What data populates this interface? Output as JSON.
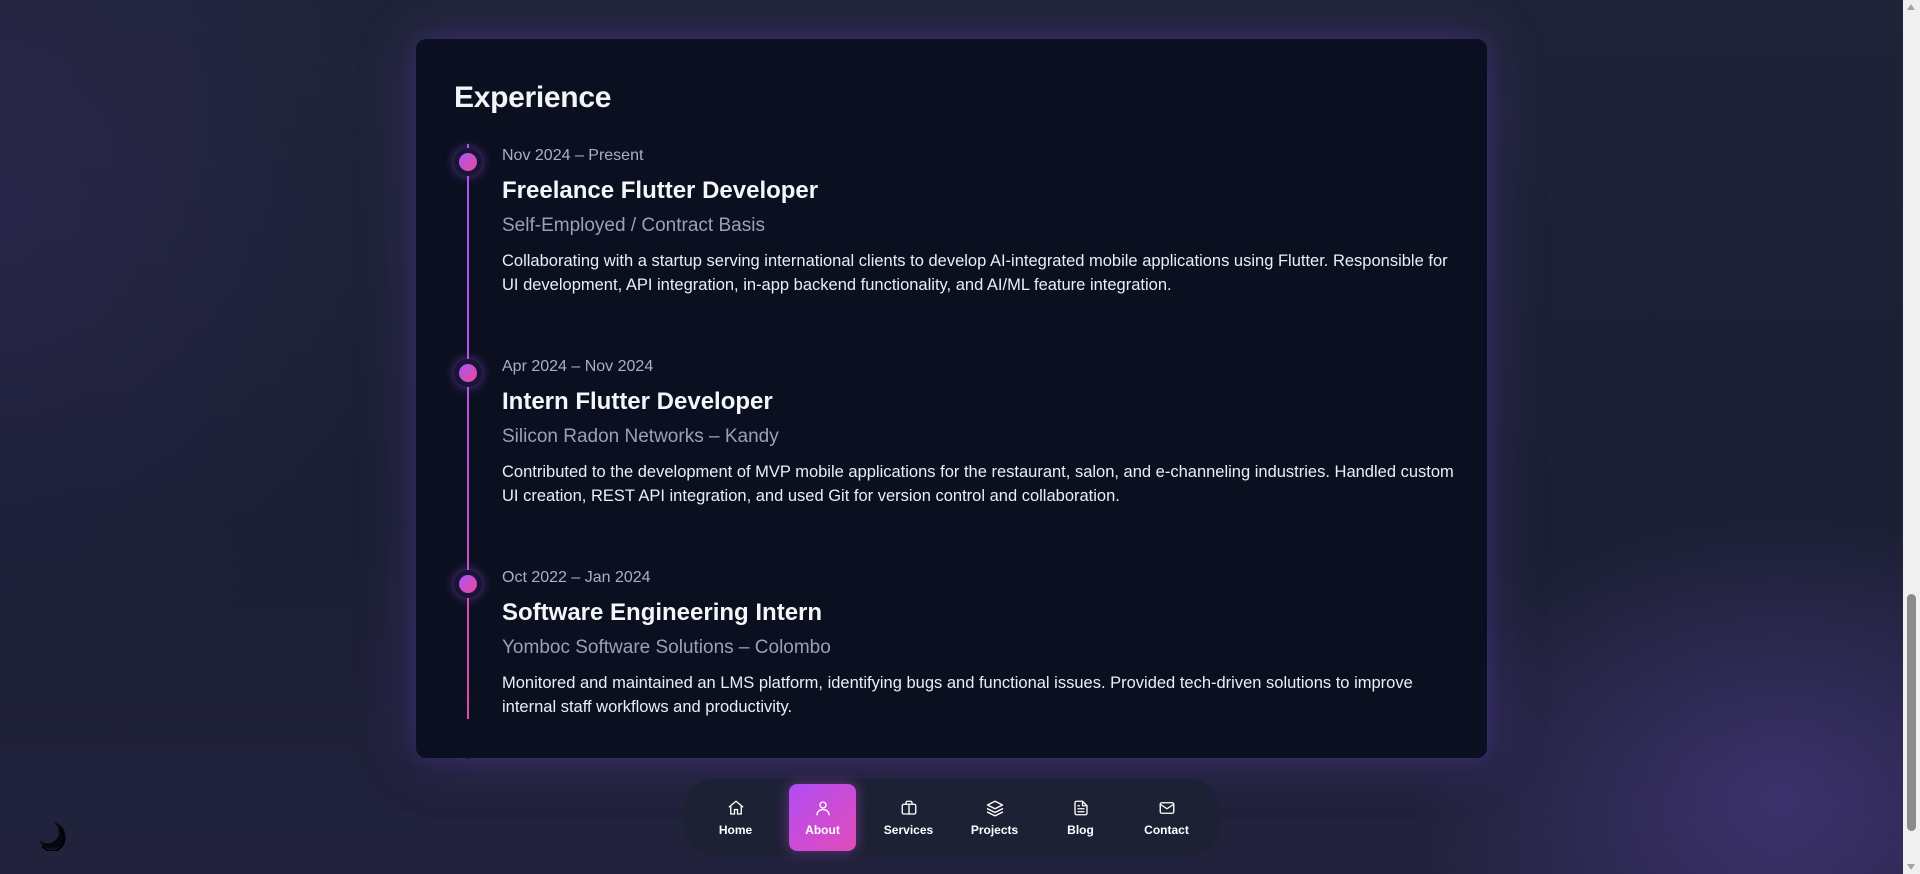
{
  "section": {
    "title": "Experience"
  },
  "experience": [
    {
      "date": "Nov 2024 – Present",
      "role": "Freelance Flutter Developer",
      "company": "Self-Employed / Contract Basis",
      "description": "Collaborating with a startup serving international clients to develop AI-integrated mobile applications using Flutter. Responsible for UI development, API integration, in-app backend functionality, and AI/ML feature integration."
    },
    {
      "date": "Apr 2024 – Nov 2024",
      "role": "Intern Flutter Developer",
      "company": "Silicon Radon Networks – Kandy",
      "description": "Contributed to the development of MVP mobile applications for the restaurant, salon, and e-channeling industries. Handled custom UI creation, REST API integration, and used Git for version control and collaboration."
    },
    {
      "date": "Oct 2022 – Jan 2024",
      "role": "Software Engineering Intern",
      "company": "Yomboc Software Solutions – Colombo",
      "description": "Monitored and maintained an LMS platform, identifying bugs and functional issues. Provided tech-driven solutions to improve internal staff workflows and productivity."
    }
  ],
  "nav": {
    "active": "About",
    "items": [
      {
        "label": "Home",
        "icon": "home-icon"
      },
      {
        "label": "About",
        "icon": "user-icon"
      },
      {
        "label": "Services",
        "icon": "briefcase-icon"
      },
      {
        "label": "Projects",
        "icon": "layers-icon"
      },
      {
        "label": "Blog",
        "icon": "file-text-icon"
      },
      {
        "label": "Contact",
        "icon": "mail-icon"
      }
    ]
  },
  "theme_toggle": {
    "icon": "moon-icon"
  },
  "colors": {
    "accent_start": "#a855f7",
    "accent_end": "#ec4899",
    "card_bg": "#0b1020",
    "page_bg": "#1f2337"
  }
}
